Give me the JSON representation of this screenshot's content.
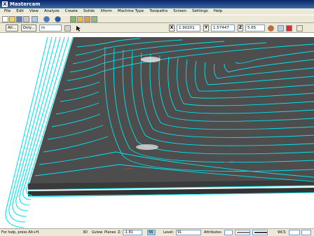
{
  "window": {
    "title": "Mastercam"
  },
  "menu": [
    "File",
    "Edit",
    "View",
    "Analyze",
    "Create",
    "Solids",
    "Xform",
    "Machine Type",
    "Toolpaths",
    "Screen",
    "Settings",
    "Help"
  ],
  "toolbar2": {
    "all_label": "All...",
    "only_label": "Only...",
    "selection_value": "in",
    "x_label": "X",
    "x_value": "1.90201",
    "y_label": "Y",
    "y_value": "1.57447",
    "z_label": "Z",
    "z_value": "5.65"
  },
  "status": {
    "help": "For help, press Alt+H.",
    "btn_3d": "3D",
    "gview": "Gview",
    "planes": "Planes",
    "z_label": "Z:",
    "z_value": "-1.81",
    "color_value": "56",
    "level_label": "Level:",
    "level_value": "91",
    "attributes": "Attributes",
    "wcs": "WCS"
  },
  "colors": {
    "toolpath": "#00e5ee",
    "surface": "#4d4d4d",
    "background": "#ffffff"
  }
}
